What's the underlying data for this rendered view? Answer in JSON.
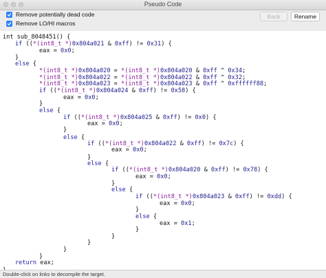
{
  "window": {
    "title": "Pseudo Code"
  },
  "options": [
    {
      "label": "Remove potentially dead code",
      "checked": true
    },
    {
      "label": "Remove LO/HI macros",
      "checked": true
    }
  ],
  "buttons": {
    "back": "Back",
    "rename": "Rename"
  },
  "code": [
    [
      [
        "p",
        "int sub_8048451() {"
      ]
    ],
    [
      [
        "k",
        "if"
      ],
      [
        "p",
        " (("
      ],
      [
        "t",
        "*(int8_t *)"
      ],
      [
        "n",
        "0x804a021"
      ],
      [
        "p",
        " & "
      ],
      [
        "n",
        "0xff"
      ],
      [
        "p",
        ") != "
      ],
      [
        "n",
        "0x31"
      ],
      [
        "p",
        ") {"
      ]
    ],
    [
      [
        "p",
        "eax = "
      ],
      [
        "n",
        "0x0"
      ],
      [
        "p",
        ";"
      ]
    ],
    [
      [
        "p",
        "}"
      ]
    ],
    [
      [
        "k",
        "else"
      ],
      [
        "p",
        " {"
      ]
    ],
    [
      [
        "t",
        "*(int8_t *)"
      ],
      [
        "n",
        "0x804a020"
      ],
      [
        "p",
        " = "
      ],
      [
        "t",
        "*(int8_t *)"
      ],
      [
        "n",
        "0x804a020"
      ],
      [
        "p",
        " & "
      ],
      [
        "n",
        "0xff"
      ],
      [
        "p",
        " ^ "
      ],
      [
        "n",
        "0x34"
      ],
      [
        "p",
        ";"
      ]
    ],
    [
      [
        "t",
        "*(int8_t *)"
      ],
      [
        "n",
        "0x804a022"
      ],
      [
        "p",
        " = "
      ],
      [
        "t",
        "*(int8_t *)"
      ],
      [
        "n",
        "0x804a022"
      ],
      [
        "p",
        " & "
      ],
      [
        "n",
        "0xff"
      ],
      [
        "p",
        " ^ "
      ],
      [
        "n",
        "0x32"
      ],
      [
        "p",
        ";"
      ]
    ],
    [
      [
        "t",
        "*(int8_t *)"
      ],
      [
        "n",
        "0x804a023"
      ],
      [
        "p",
        " = "
      ],
      [
        "t",
        "*(int8_t *)"
      ],
      [
        "n",
        "0x804a023"
      ],
      [
        "p",
        " & "
      ],
      [
        "n",
        "0xff"
      ],
      [
        "p",
        " ^ "
      ],
      [
        "n",
        "0xffffff88"
      ],
      [
        "p",
        ";"
      ]
    ],
    [
      [
        "k",
        "if"
      ],
      [
        "p",
        " (("
      ],
      [
        "t",
        "*(int8_t *)"
      ],
      [
        "n",
        "0x804a024"
      ],
      [
        "p",
        " & "
      ],
      [
        "n",
        "0xff"
      ],
      [
        "p",
        ") != "
      ],
      [
        "n",
        "0x58"
      ],
      [
        "p",
        ") {"
      ]
    ],
    [
      [
        "p",
        "eax = "
      ],
      [
        "n",
        "0x0"
      ],
      [
        "p",
        ";"
      ]
    ],
    [
      [
        "p",
        "}"
      ]
    ],
    [
      [
        "k",
        "else"
      ],
      [
        "p",
        " {"
      ]
    ],
    [
      [
        "k",
        "if"
      ],
      [
        "p",
        " (("
      ],
      [
        "t",
        "*(int8_t *)"
      ],
      [
        "n",
        "0x804a025"
      ],
      [
        "p",
        " & "
      ],
      [
        "n",
        "0xff"
      ],
      [
        "p",
        ") != "
      ],
      [
        "n",
        "0x0"
      ],
      [
        "p",
        ") {"
      ]
    ],
    [
      [
        "p",
        "eax = "
      ],
      [
        "n",
        "0x0"
      ],
      [
        "p",
        ";"
      ]
    ],
    [
      [
        "p",
        "}"
      ]
    ],
    [
      [
        "k",
        "else"
      ],
      [
        "p",
        " {"
      ]
    ],
    [
      [
        "k",
        "if"
      ],
      [
        "p",
        " (("
      ],
      [
        "t",
        "*(int8_t *)"
      ],
      [
        "n",
        "0x804a022"
      ],
      [
        "p",
        " & "
      ],
      [
        "n",
        "0xff"
      ],
      [
        "p",
        ") != "
      ],
      [
        "n",
        "0x7c"
      ],
      [
        "p",
        ") {"
      ]
    ],
    [
      [
        "p",
        "eax = "
      ],
      [
        "n",
        "0x0"
      ],
      [
        "p",
        ";"
      ]
    ],
    [
      [
        "p",
        "}"
      ]
    ],
    [
      [
        "k",
        "else"
      ],
      [
        "p",
        " {"
      ]
    ],
    [
      [
        "k",
        "if"
      ],
      [
        "p",
        " (("
      ],
      [
        "t",
        "*(int8_t *)"
      ],
      [
        "n",
        "0x804a020"
      ],
      [
        "p",
        " & "
      ],
      [
        "n",
        "0xff"
      ],
      [
        "p",
        ") != "
      ],
      [
        "n",
        "0x78"
      ],
      [
        "p",
        ") {"
      ]
    ],
    [
      [
        "p",
        "eax = "
      ],
      [
        "n",
        "0x0"
      ],
      [
        "p",
        ";"
      ]
    ],
    [
      [
        "p",
        "}"
      ]
    ],
    [
      [
        "k",
        "else"
      ],
      [
        "p",
        " {"
      ]
    ],
    [
      [
        "k",
        "if"
      ],
      [
        "p",
        " (("
      ],
      [
        "t",
        "*(int8_t *)"
      ],
      [
        "n",
        "0x804a023"
      ],
      [
        "p",
        " & "
      ],
      [
        "n",
        "0xff"
      ],
      [
        "p",
        ") != "
      ],
      [
        "n",
        "0xdd"
      ],
      [
        "p",
        ") {"
      ]
    ],
    [
      [
        "p",
        "eax = "
      ],
      [
        "n",
        "0x0"
      ],
      [
        "p",
        ";"
      ]
    ],
    [
      [
        "p",
        "}"
      ]
    ],
    [
      [
        "k",
        "else"
      ],
      [
        "p",
        " {"
      ]
    ],
    [
      [
        "p",
        "eax = "
      ],
      [
        "n",
        "0x1"
      ],
      [
        "p",
        ";"
      ]
    ],
    [
      [
        "p",
        "}"
      ]
    ],
    [
      [
        "p",
        "}"
      ]
    ],
    [
      [
        "p",
        "}"
      ]
    ],
    [
      [
        "p",
        "}"
      ]
    ],
    [
      [
        "p",
        "}"
      ]
    ],
    [
      [
        "k",
        "return"
      ],
      [
        "p",
        " eax;"
      ]
    ],
    [
      [
        "p",
        "}"
      ]
    ]
  ],
  "status": "Double-click on links to decompile the target."
}
